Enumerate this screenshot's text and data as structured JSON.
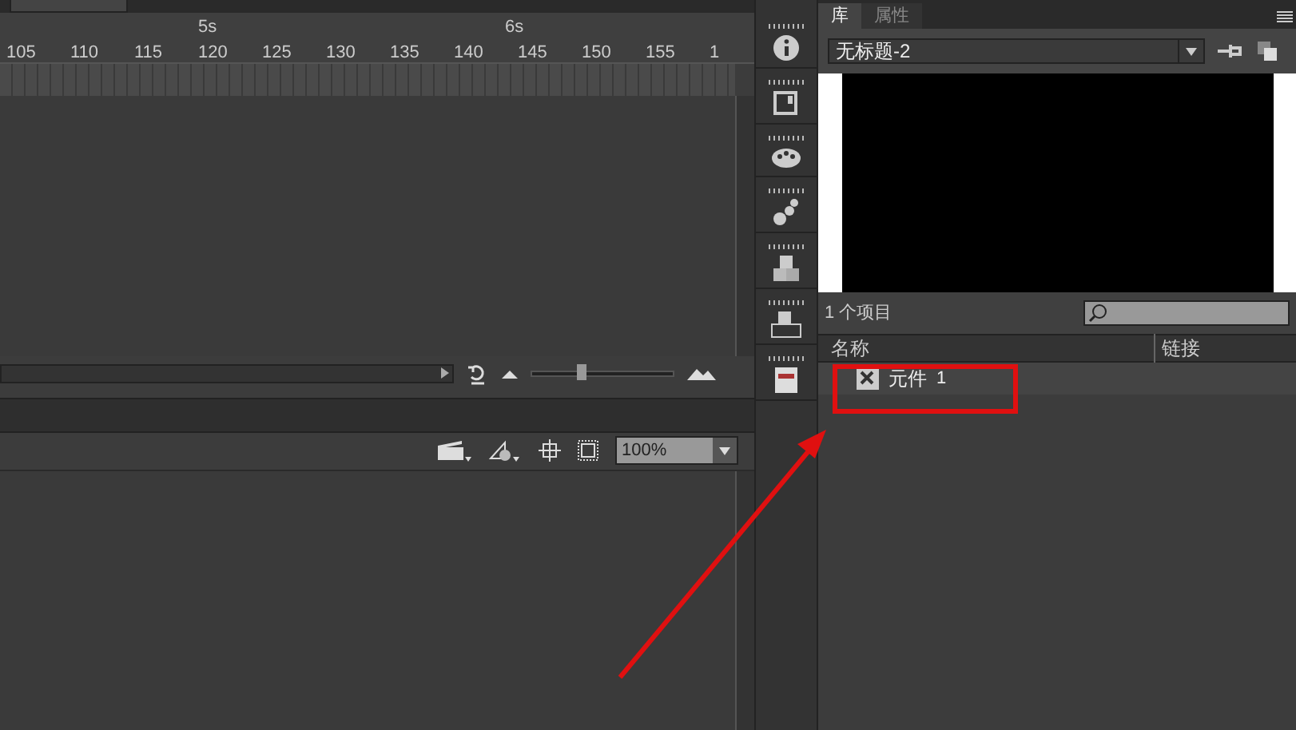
{
  "timeline": {
    "seconds": [
      "5s",
      "6s"
    ],
    "frames": [
      "105",
      "110",
      "115",
      "120",
      "125",
      "130",
      "135",
      "140",
      "145",
      "150",
      "155",
      "1"
    ],
    "zoom_slider": {
      "level": 0.32
    }
  },
  "stage_toolbar": {
    "zoom": "100%"
  },
  "panel": {
    "tabs": [
      {
        "label": "库",
        "selected": true
      },
      {
        "label": "属性",
        "selected": false
      }
    ],
    "document": "无标题-2",
    "count": "1 个项目",
    "columns": [
      "名称",
      "链接"
    ],
    "items": [
      {
        "name": "元件",
        "suffix": "1"
      }
    ]
  }
}
